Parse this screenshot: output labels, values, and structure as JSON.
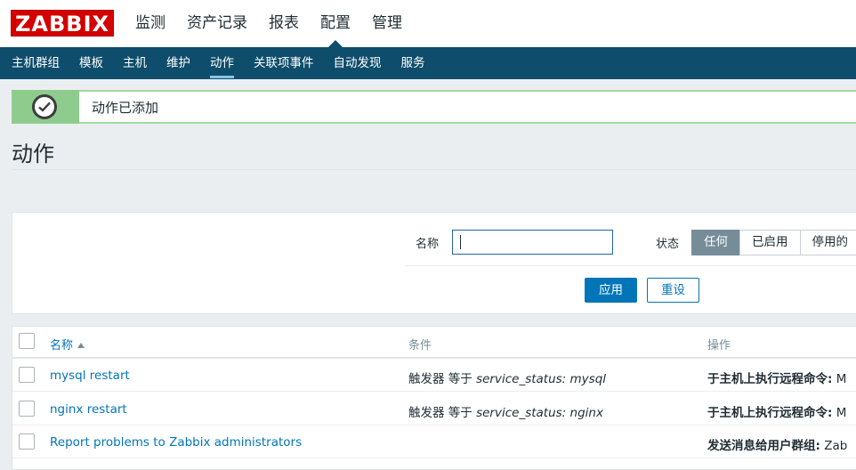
{
  "brand": {
    "logo": "ZABBIX"
  },
  "main_menu": [
    {
      "label": "监测"
    },
    {
      "label": "资产记录"
    },
    {
      "label": "报表"
    },
    {
      "label": "配置",
      "active": true
    },
    {
      "label": "管理"
    }
  ],
  "sub_menu": [
    {
      "label": "主机群组"
    },
    {
      "label": "模板"
    },
    {
      "label": "主机"
    },
    {
      "label": "维护"
    },
    {
      "label": "动作",
      "active": true
    },
    {
      "label": "关联项事件"
    },
    {
      "label": "自动发现"
    },
    {
      "label": "服务"
    }
  ],
  "message": {
    "text": "动作已添加",
    "icon": "check-circle-icon"
  },
  "page": {
    "title": "动作"
  },
  "filter": {
    "name_label": "名称",
    "name_value": "",
    "status_label": "状态",
    "status_options": [
      "任何",
      "已启用",
      "停用的"
    ],
    "status_selected": "任何",
    "apply_label": "应用",
    "reset_label": "重设"
  },
  "table": {
    "headers": {
      "name": "名称",
      "conditions": "条件",
      "operations": "操作"
    },
    "rows": [
      {
        "name": "mysql restart",
        "cond_prefix": "触发器 等于 ",
        "cond_value": "service_status: mysql",
        "op_label": "于主机上执行远程命令:",
        "op_value": " M"
      },
      {
        "name": "nginx restart",
        "cond_prefix": "触发器 等于 ",
        "cond_value": "service_status: nginx",
        "op_label": "于主机上执行远程命令:",
        "op_value": " M"
      },
      {
        "name": "Report problems to Zabbix administrators",
        "cond_prefix": "",
        "cond_value": "",
        "op_label": "发送消息给用户群组:",
        "op_value": " Zab"
      }
    ]
  },
  "colors": {
    "header_bg": "#0e4d6b",
    "logo_red": "#d40000",
    "link": "#0275b8",
    "success_green": "#8ecc8e"
  }
}
